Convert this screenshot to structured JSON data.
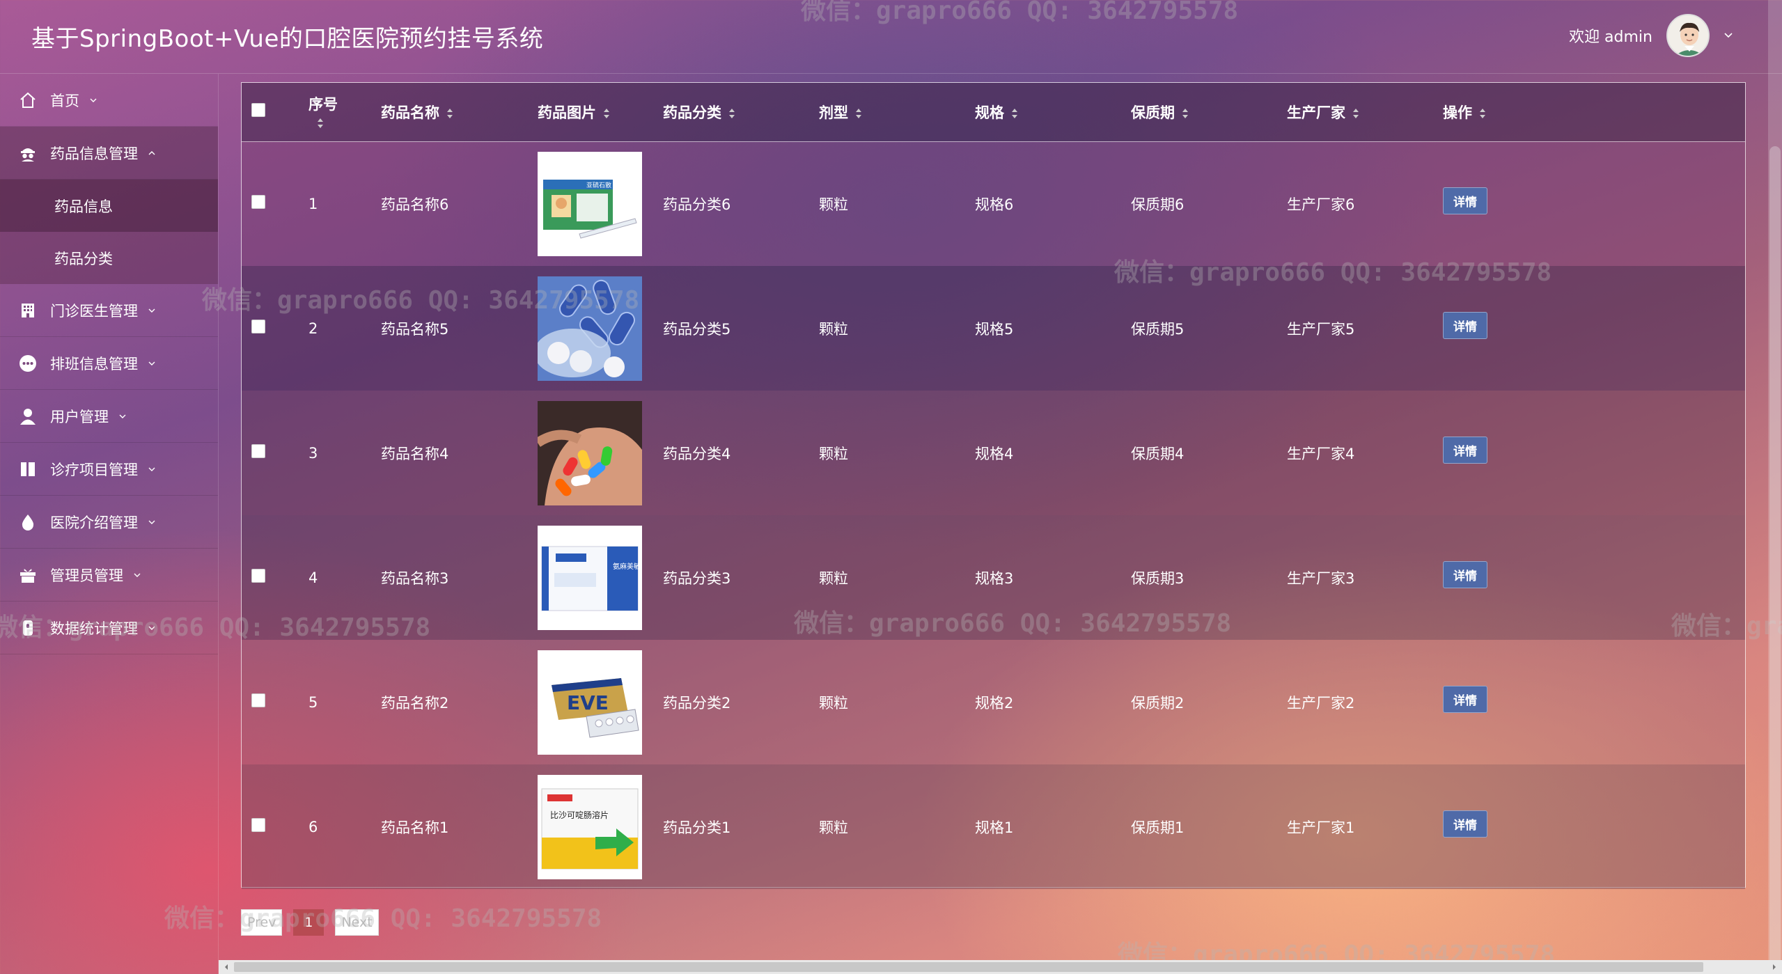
{
  "app": {
    "title": "基于SpringBoot+Vue的口腔医院预约挂号系统"
  },
  "user": {
    "welcome": "欢迎 admin"
  },
  "sidebar": {
    "items": [
      {
        "label": "首页",
        "icon": "home-icon"
      },
      {
        "label": "药品信息管理",
        "icon": "user-secret-icon",
        "open": true,
        "children": [
          {
            "label": "药品信息",
            "active": true
          },
          {
            "label": "药品分类"
          }
        ]
      },
      {
        "label": "门诊医生管理",
        "icon": "building-icon"
      },
      {
        "label": "排班信息管理",
        "icon": "dots-circle-icon"
      },
      {
        "label": "用户管理",
        "icon": "user-icon"
      },
      {
        "label": "诊疗项目管理",
        "icon": "book-icon"
      },
      {
        "label": "医院介绍管理",
        "icon": "drop-icon"
      },
      {
        "label": "管理员管理",
        "icon": "gift-icon"
      },
      {
        "label": "数据统计管理",
        "icon": "phone-icon"
      }
    ]
  },
  "table": {
    "headers": [
      "序号",
      "药品名称",
      "药品图片",
      "药品分类",
      "剂型",
      "规格",
      "保质期",
      "生产厂家",
      "操作"
    ],
    "rows": [
      {
        "no": "1",
        "name": "药品名称6",
        "category": "药品分类6",
        "form": "颗粒",
        "spec": "规格6",
        "shelf": "保质期6",
        "maker": "生产厂家6"
      },
      {
        "no": "2",
        "name": "药品名称5",
        "category": "药品分类5",
        "form": "颗粒",
        "spec": "规格5",
        "shelf": "保质期5",
        "maker": "生产厂家5"
      },
      {
        "no": "3",
        "name": "药品名称4",
        "category": "药品分类4",
        "form": "颗粒",
        "spec": "规格4",
        "shelf": "保质期4",
        "maker": "生产厂家4"
      },
      {
        "no": "4",
        "name": "药品名称3",
        "category": "药品分类3",
        "form": "颗粒",
        "spec": "规格3",
        "shelf": "保质期3",
        "maker": "生产厂家3"
      },
      {
        "no": "5",
        "name": "药品名称2",
        "category": "药品分类2",
        "form": "颗粒",
        "spec": "规格2",
        "shelf": "保质期2",
        "maker": "生产厂家2"
      },
      {
        "no": "6",
        "name": "药品名称1",
        "category": "药品分类1",
        "form": "颗粒",
        "spec": "规格1",
        "shelf": "保质期1",
        "maker": "生产厂家1"
      }
    ],
    "detail_label": "详情",
    "image_texts": [
      "亚硫石散",
      "氨麻美敏片",
      "EVE",
      "比沙可啶肠溶片"
    ]
  },
  "pagination": {
    "prev": "Prev",
    "current": "1",
    "next": "Next"
  },
  "watermark": {
    "text": "微信：grapro666 QQ: 3642795578"
  }
}
